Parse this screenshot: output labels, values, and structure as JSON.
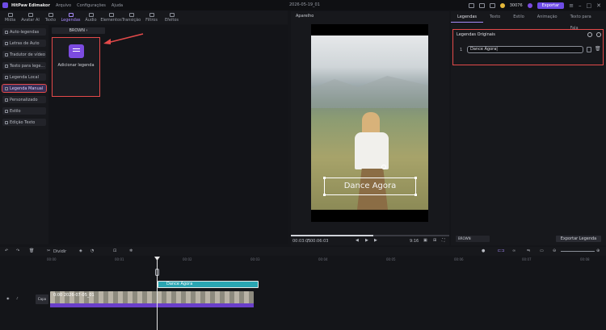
{
  "titlebar": {
    "app_name": "HitPaw Edimakor",
    "menus": [
      "Arquivo",
      "Configurações",
      "Ajuda"
    ],
    "project_name": "2026-05-19_01",
    "coins": "30076",
    "export_label": "Exportar"
  },
  "toolbar": {
    "tabs": [
      {
        "label": "Mídia",
        "icon": "media-icon"
      },
      {
        "label": "Avatar AI",
        "icon": "avatar-icon"
      },
      {
        "label": "Texto",
        "icon": "text-icon"
      },
      {
        "label": "Legendas",
        "icon": "captions-icon"
      },
      {
        "label": "Áudio",
        "icon": "audio-icon"
      },
      {
        "label": "Elementos",
        "icon": "elements-icon"
      },
      {
        "label": "Transição",
        "icon": "transition-icon"
      },
      {
        "label": "Filtros",
        "icon": "filters-icon"
      },
      {
        "label": "Efeitos",
        "icon": "effects-icon"
      }
    ],
    "active": "Legendas"
  },
  "sidebar": {
    "items": [
      {
        "label": "Auto-legendas"
      },
      {
        "label": "Letras de Auto"
      },
      {
        "label": "Tradutor de vídeo"
      },
      {
        "label": "Texto para lege..."
      },
      {
        "label": "Legenda Local"
      },
      {
        "label": "Legenda Manual"
      },
      {
        "label": "Personalizado"
      },
      {
        "label": "Estilo"
      },
      {
        "label": "Edição Texto"
      }
    ],
    "active": "Legenda Manual"
  },
  "media": {
    "category": "BROWN",
    "card_label": "Adicionar legenda"
  },
  "preview": {
    "title": "Aparelho",
    "subtitle_text": "Dance Agora",
    "time_current": "00:03:05",
    "time_total": "00:06:03",
    "aspect": "9:16",
    "progress": 0.52
  },
  "right_panel": {
    "tabs": [
      "Legendas",
      "Texto",
      "Estilo",
      "Animação",
      "Texto para Fala"
    ],
    "active_tab": "Legendas",
    "section_title": "Legendas Originais",
    "rows": [
      {
        "index": "1",
        "text": "Dance Agora|"
      }
    ],
    "style_select": "BROWN",
    "export_button": "Exportar Legenda"
  },
  "timeline": {
    "split_label": "Dividir",
    "subtitle_clip": "Dance Agora",
    "video_clip_label": "0:00 2026-07-05_01",
    "cover_label": "Capa",
    "ruler_marks": [
      "00:00",
      "00:01",
      "00:02",
      "00:03",
      "00:04",
      "00:05",
      "00:06",
      "00:07",
      "00:08",
      "00:09",
      "00:10",
      "00:11",
      "00:12",
      "00:13",
      "00:14"
    ]
  }
}
